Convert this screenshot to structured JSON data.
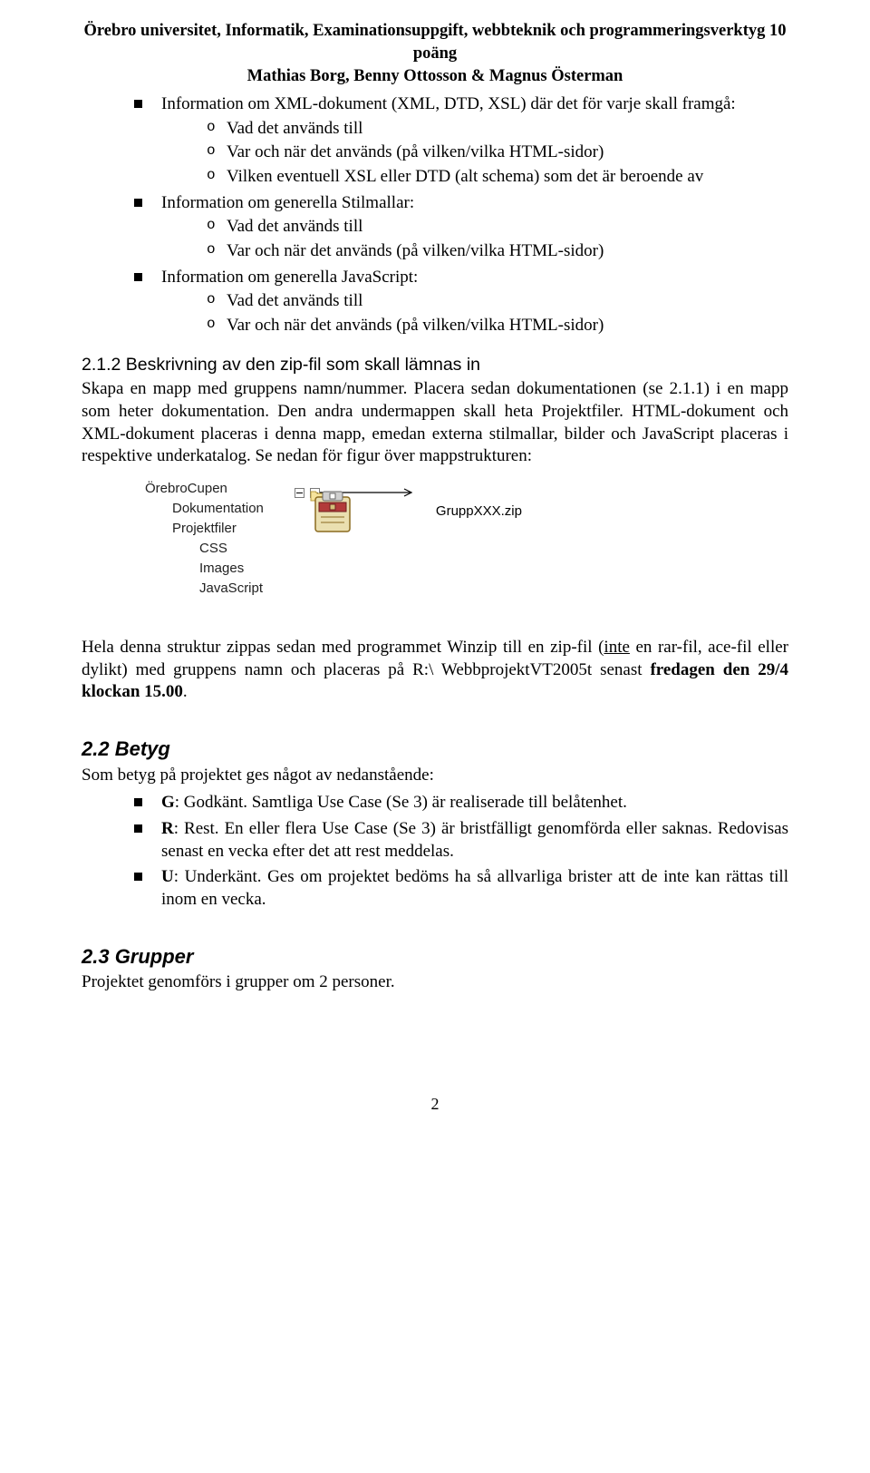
{
  "header": {
    "line1": "Örebro universitet, Informatik, Examinationsuppgift, webbteknik och programmeringsverktyg 10 poäng",
    "line2": "Mathias Borg, Benny Ottosson & Magnus Österman"
  },
  "bullets": {
    "xml_intro": "Information om XML-dokument (XML, DTD, XSL) där det för varje skall framgå:",
    "xml_o1": "Vad det används till",
    "xml_o2": "Var och när det används (på vilken/vilka HTML-sidor)",
    "xml_o3": "Vilken eventuell XSL eller DTD (alt schema) som det är beroende av",
    "stil_intro": "Information om generella Stilmallar:",
    "stil_o1": "Vad det används till",
    "stil_o2": "Var och när det används (på vilken/vilka HTML-sidor)",
    "js_intro": "Information om generella JavaScript:",
    "js_o1": "Vad det används till",
    "js_o2": "Var och när det används (på vilken/vilka HTML-sidor)"
  },
  "s212": {
    "heading": "2.1.2   Beskrivning av den zip-fil som skall lämnas in",
    "para": "Skapa en mapp med gruppens namn/nummer. Placera sedan dokumentationen (se 2.1.1) i en mapp som heter dokumentation. Den andra undermappen skall heta Projektfiler. HTML-dokument och XML-dokument placeras i denna mapp, emedan externa stilmallar, bilder och JavaScript placeras i respektive underkatalog. Se nedan för figur över mappstrukturen:"
  },
  "tree": {
    "n1": "ÖrebroCupen",
    "n2": "Dokumentation",
    "n3": "Projektfiler",
    "n4": "CSS",
    "n5": "Images",
    "n6": "JavaScript"
  },
  "zip_label": "GruppXXX.zip",
  "zip_para_a": "Hela denna struktur zippas sedan med programmet Winzip till en zip-fil (",
  "zip_para_u": "inte",
  "zip_para_b": " en rar-fil, ace-fil eller dylikt) med gruppens namn och placeras på R:\\ WebbprojektVT2005t senast ",
  "zip_para_bold": "fredagen den 29/4 klockan 15.00",
  "zip_para_end": ".",
  "s22": {
    "heading": "2.2   Betyg",
    "intro": "Som betyg på projektet ges något av nedanstående:",
    "g_bold": "G",
    "g_text": ": Godkänt. Samtliga Use Case (Se 3) är realiserade till belåtenhet.",
    "r_bold": "R",
    "r_text": ": Rest. En eller flera Use Case (Se 3) är bristfälligt genomförda eller saknas. Redovisas senast en vecka efter det att rest meddelas.",
    "u_bold": "U",
    "u_text": ": Underkänt. Ges om projektet bedöms ha så allvarliga brister att de inte kan rättas till inom en vecka."
  },
  "s23": {
    "heading": "2.3   Grupper",
    "text": "Projektet genomförs i grupper om 2 personer."
  },
  "page_number": "2"
}
